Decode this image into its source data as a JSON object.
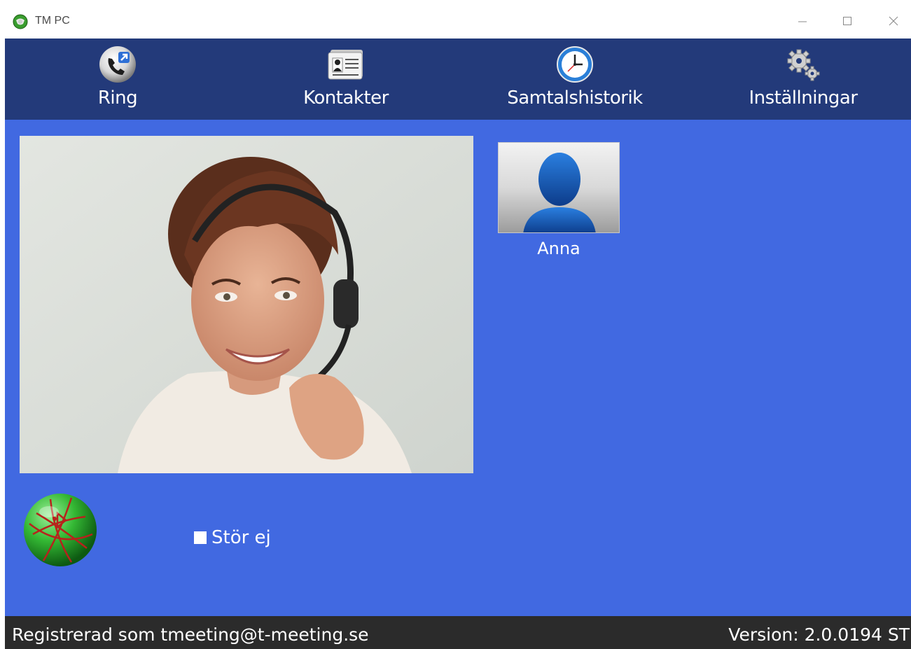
{
  "window": {
    "title": "TM PC",
    "controls": [
      "minimize",
      "maximize",
      "close"
    ]
  },
  "nav": {
    "items": [
      {
        "label": "Ring",
        "icon": "phone-call-icon"
      },
      {
        "label": "Kontakter",
        "icon": "contact-card-icon"
      },
      {
        "label": "Samtalshistorik",
        "icon": "clock-icon"
      },
      {
        "label": "Inställningar",
        "icon": "gears-icon"
      }
    ]
  },
  "main": {
    "photo": "operator-with-headset-image",
    "contacts": [
      {
        "name": "Anna",
        "icon": "person-silhouette-icon"
      }
    ],
    "status_icon": "globe-icon",
    "do_not_disturb": {
      "label": "Stör ej",
      "checked": false
    }
  },
  "statusbar": {
    "registered": "Registrerad som tmeeting@t-meeting.se",
    "version": "Version: 2.0.0194 ST"
  },
  "colors": {
    "navbar": "#233a7a",
    "main_bg": "#4169e1",
    "statusbar": "#2b2b2b"
  }
}
